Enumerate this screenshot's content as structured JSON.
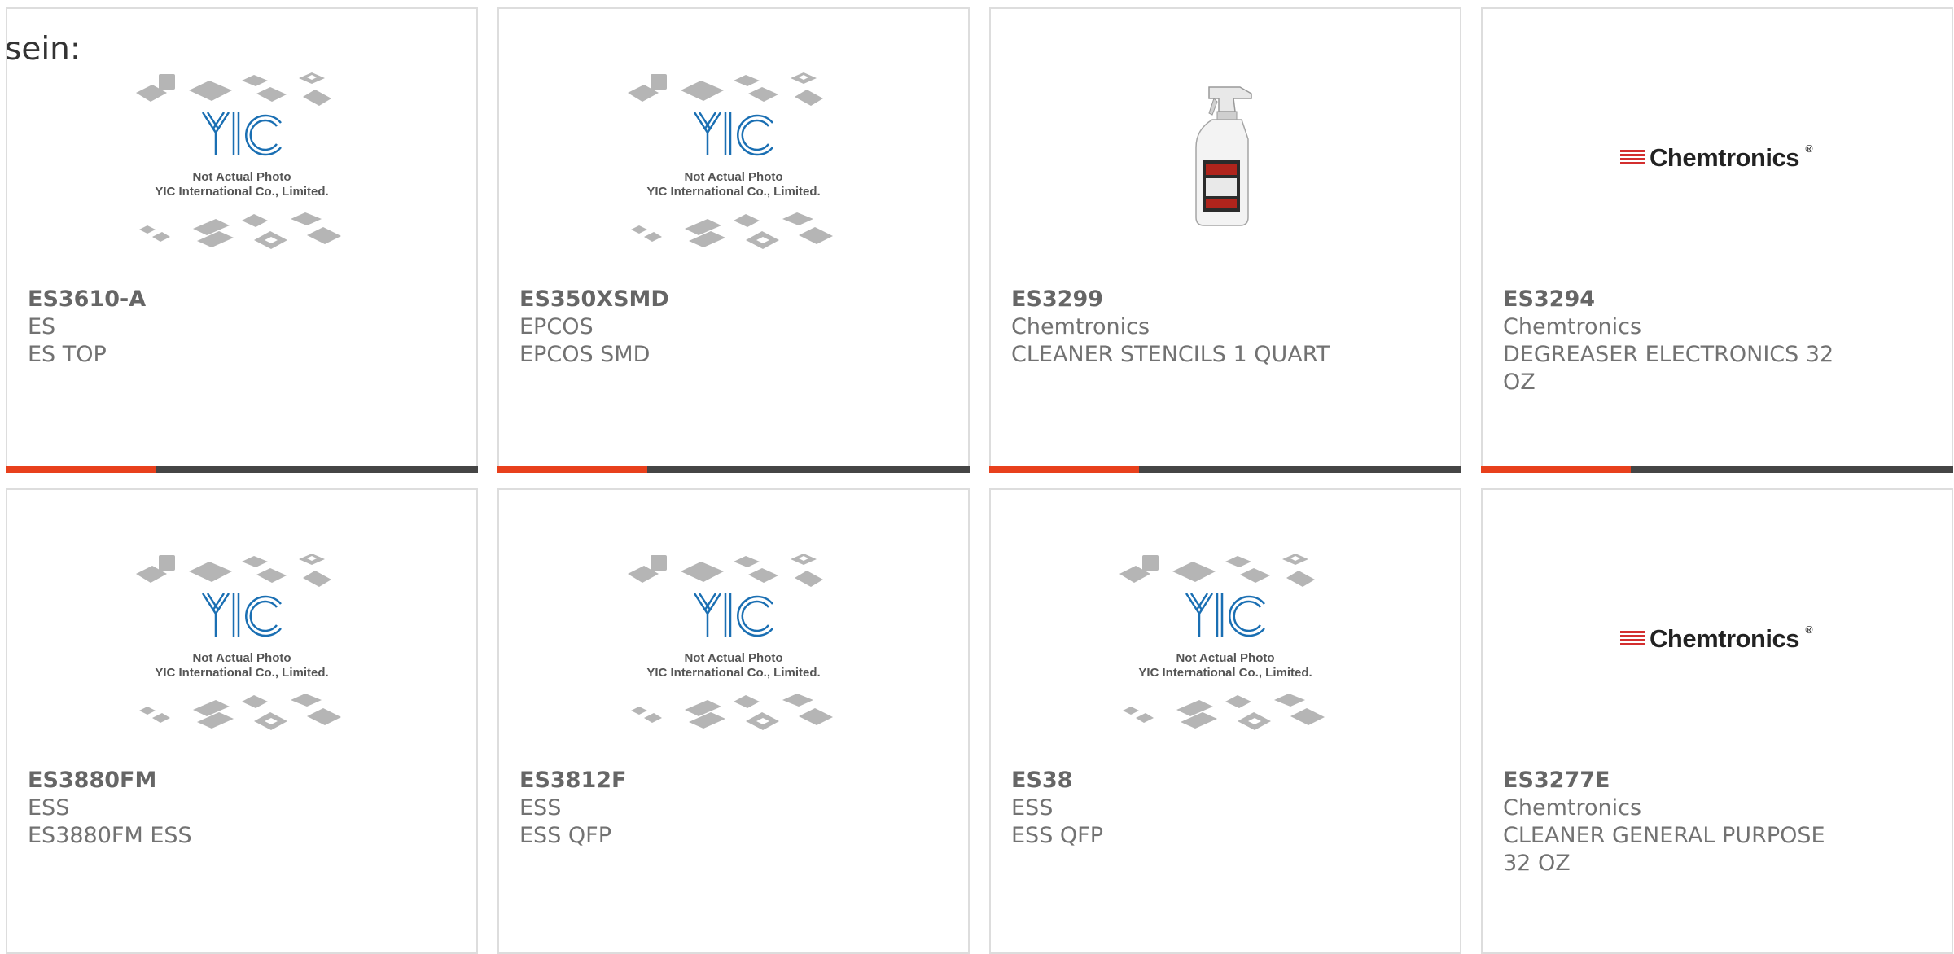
{
  "intro_text": "sein:",
  "placeholder": {
    "line1": "Not Actual Photo",
    "line2": "YIC International Co., Limited."
  },
  "chem_logo_text": "Chemtronics",
  "chem_logo_mark": "®",
  "products": [
    {
      "part": "ES3610-A",
      "manufacturer": "ES",
      "description": "ES TOP",
      "image": "yic-placeholder"
    },
    {
      "part": "ES350XSMD",
      "manufacturer": "EPCOS",
      "description": "EPCOS SMD",
      "image": "yic-placeholder"
    },
    {
      "part": "ES3299",
      "manufacturer": "Chemtronics",
      "description": "CLEANER STENCILS 1 QUART",
      "image": "spray-bottle"
    },
    {
      "part": "ES3294",
      "manufacturer": "Chemtronics",
      "description": "DEGREASER ELECTRONICS 32 OZ",
      "image": "chemtronics-logo"
    },
    {
      "part": "ES3880FM",
      "manufacturer": "ESS",
      "description": "ES3880FM ESS",
      "image": "yic-placeholder"
    },
    {
      "part": "ES3812F",
      "manufacturer": "ESS",
      "description": "ESS QFP",
      "image": "yic-placeholder"
    },
    {
      "part": "ES38",
      "manufacturer": "ESS",
      "description": "ESS QFP",
      "image": "yic-placeholder"
    },
    {
      "part": "ES3277E",
      "manufacturer": "Chemtronics",
      "description": "CLEANER GENERAL PURPOSE 32 OZ",
      "image": "chemtronics-logo"
    }
  ],
  "colors": {
    "accent": "#e8401c",
    "bar": "#454545",
    "yic_blue": "#1a6fb3",
    "card_border": "#dddddd"
  }
}
